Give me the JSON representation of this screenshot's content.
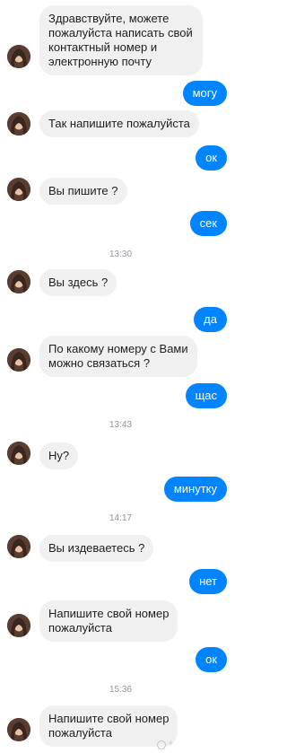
{
  "colors": {
    "incoming_bubble": "#f1f0f0",
    "outgoing_bubble": "#0084ff",
    "timestamp": "#90949c"
  },
  "messages": [
    {
      "type": "in",
      "text": "Здравствуйте, можете\nпожалуйста написать свой\nконтактный номер и\nэлектронную почту"
    },
    {
      "type": "out",
      "text": "могу"
    },
    {
      "type": "in",
      "text": "Так напишите пожалуйста"
    },
    {
      "type": "out",
      "text": "ок"
    },
    {
      "type": "in",
      "text": "Вы пишите ?"
    },
    {
      "type": "out",
      "text": "сек"
    },
    {
      "type": "time",
      "text": "13:30"
    },
    {
      "type": "in",
      "text": "Вы здесь ?"
    },
    {
      "type": "out",
      "text": "да"
    },
    {
      "type": "in",
      "text": "По какому номеру с Вами\nможно связаться ?"
    },
    {
      "type": "out",
      "text": "щас"
    },
    {
      "type": "time",
      "text": "13:43"
    },
    {
      "type": "in",
      "text": "Ну?"
    },
    {
      "type": "out",
      "text": "минутку"
    },
    {
      "type": "time",
      "text": "14:17"
    },
    {
      "type": "in",
      "text": "Вы издеваетесь ?"
    },
    {
      "type": "out",
      "text": "нет"
    },
    {
      "type": "in",
      "text": "Напишите свой номер\nпожалуйста"
    },
    {
      "type": "out",
      "text": "ок"
    },
    {
      "type": "time",
      "text": "15:36"
    },
    {
      "type": "in",
      "text": "Напишите свой номер\nпожалуйста"
    }
  ],
  "icons": {
    "avatar": "contact-avatar-icon",
    "seen": "seen-indicator-icon"
  }
}
